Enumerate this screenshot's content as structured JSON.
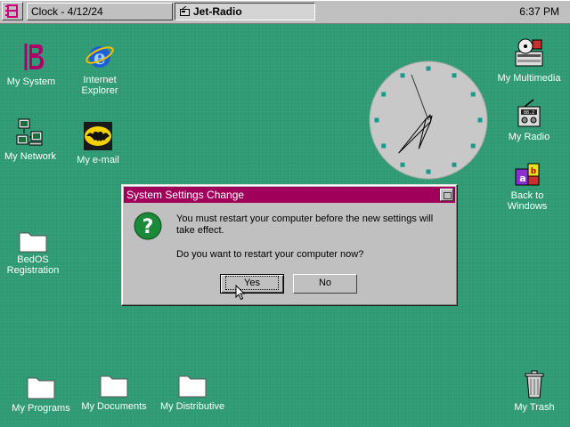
{
  "taskbar": {
    "start_icon": "system-logo-icon",
    "tasks": [
      {
        "label": "Clock - 4/12/24"
      },
      {
        "label": "Jet-Radio",
        "icon": "radio-icon"
      }
    ],
    "time": "6:37 PM"
  },
  "desktop": {
    "icons": [
      {
        "label": "My System",
        "icon": "system-logo-icon"
      },
      {
        "label": "Internet\nExplorer",
        "icon": "internet-explorer-icon"
      },
      {
        "label": "My Network",
        "icon": "network-icon"
      },
      {
        "label": "My e-mail",
        "icon": "bat-mail-icon"
      },
      {
        "label": "BedOS\nRegistration",
        "icon": "folder-icon"
      },
      {
        "label": "My Programs",
        "icon": "folder-icon"
      },
      {
        "label": "My Documents",
        "icon": "folder-icon"
      },
      {
        "label": "My Distributive",
        "icon": "folder-icon"
      },
      {
        "label": "My Multimedia",
        "icon": "multimedia-icon"
      },
      {
        "label": "My Radio",
        "icon": "radio-icon"
      },
      {
        "label": "Back to\nWindows",
        "icon": "abc-blocks-icon"
      },
      {
        "label": "My Trash",
        "icon": "trash-icon"
      }
    ]
  },
  "clock": {
    "hour": 6,
    "minute": 37,
    "icon": "analog-clock-icon"
  },
  "dialog": {
    "title": "System Settings Change",
    "message1": "You must restart your computer before the new settings will take effect.",
    "message2": "Do you want to restart your computer now?",
    "yes_label": "Yes",
    "no_label": "No",
    "icon": "question-icon"
  },
  "colors": {
    "desktop": "#2e9b74",
    "titlebar": "#a0005a",
    "chrome": "#c0c0c0"
  }
}
